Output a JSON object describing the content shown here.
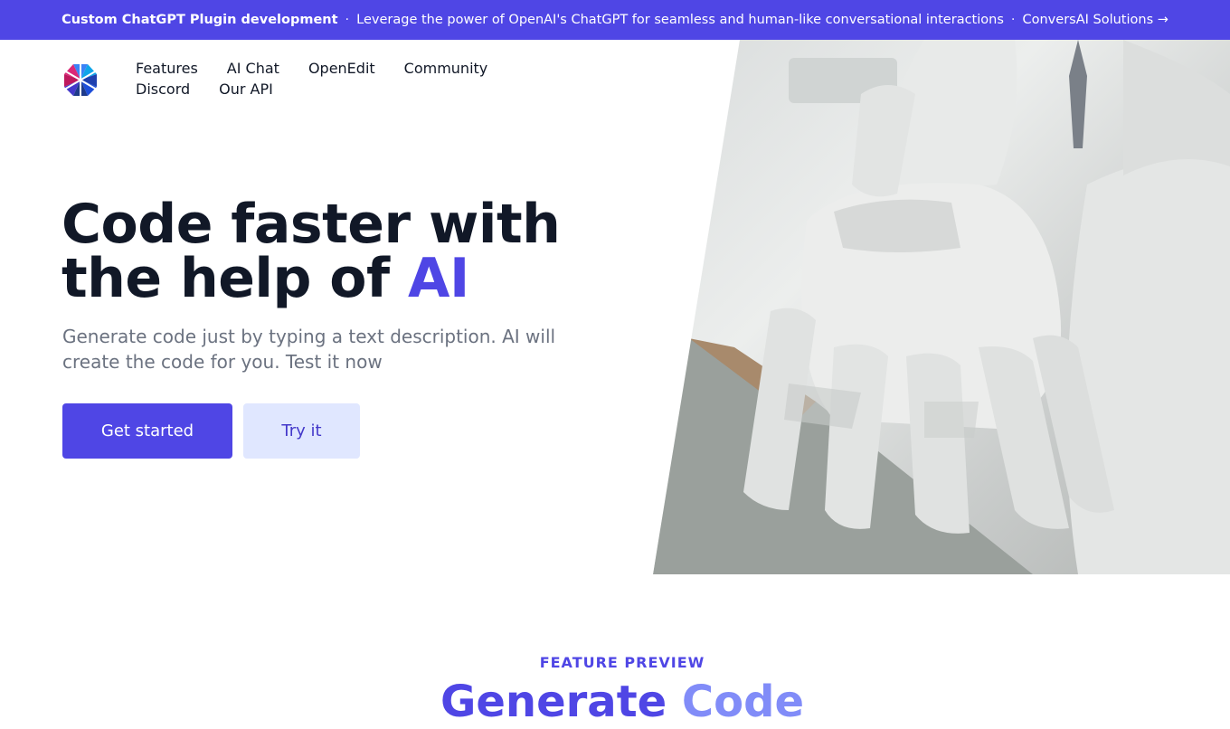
{
  "banner": {
    "title": "Custom ChatGPT Plugin development",
    "separator": "·",
    "message": "Leverage the power of OpenAI's ChatGPT for seamless and human-like conversational interactions",
    "link_label": "ConversAI Solutions →"
  },
  "nav": {
    "row1": [
      "Features",
      "AI Chat",
      "OpenEdit",
      "Community"
    ],
    "row2": [
      "Discord",
      "Our API"
    ]
  },
  "hero": {
    "headline_part1": "Code faster with the help of ",
    "headline_accent": "AI",
    "subtext": "Generate code just by typing a text description. AI will create the code for you. Test it now",
    "primary_button": "Get started",
    "secondary_button": "Try it"
  },
  "features": {
    "eyebrow": "FEATURE PREVIEW",
    "title_part1": "Generate",
    "title_part2": "Code"
  },
  "colors": {
    "brand": "#4f46e5",
    "brand_light": "#e0e7ff",
    "headline": "#111827",
    "muted": "#6b7280"
  },
  "icons": [
    "logo-icon",
    "robot-hand-photo"
  ]
}
